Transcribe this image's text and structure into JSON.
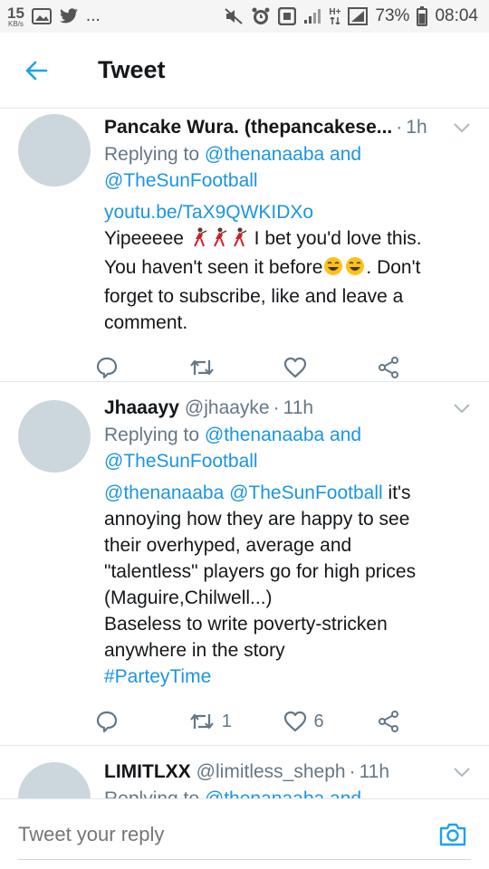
{
  "status_bar": {
    "speed_value": "15",
    "speed_unit": "KB/s",
    "more": "...",
    "signal_label": "H+",
    "battery": "73%",
    "time": "08:04"
  },
  "header": {
    "title": "Tweet"
  },
  "tweets": [
    {
      "name": "Pancake Wura. (thepancakese...",
      "handle": "",
      "time": "1h",
      "replying_prefix": "Replying to",
      "reply_mention_1": "@thenanaaba",
      "reply_and": "and",
      "reply_mention_2": "@TheSunFootball",
      "link": "youtu.be/TaX9QWKIDXo",
      "body_1": "Yipeeeee",
      "body_2": " I bet you'd love this.\nYou haven't seen it before",
      "body_3": ". Don't\nforget to subscribe, like and leave a\ncomment.",
      "retweets": "",
      "likes": ""
    },
    {
      "name": "Jhaaayy",
      "handle": "@jhaayke",
      "time": "11h",
      "replying_prefix": "Replying to",
      "reply_mention_1": "@thenanaaba",
      "reply_and": "and",
      "reply_mention_2": "@TheSunFootball",
      "body_mention_1": "@thenanaaba",
      "body_mention_2": "@TheSunFootball",
      "body_text": " it's\nannoying how they are happy to see\ntheir overhyped, average and\n\"talentless\" players go for high prices\n(Maguire,Chilwell...)\nBaseless to write poverty-stricken\nanywhere in the story",
      "hashtag": "#ParteyTime",
      "retweets": "1",
      "likes": "6"
    },
    {
      "name": "LIMITLXX",
      "handle": "@limitless_sheph",
      "time": "11h",
      "replying_prefix": "Replying to",
      "reply_mention_1": "@thenanaaba",
      "reply_and": "and"
    }
  ],
  "reply_bar": {
    "placeholder": "Tweet your reply"
  },
  "colors": {
    "accent": "#1b95e0",
    "muted": "#657786",
    "avatar": "#ccd6dd"
  }
}
